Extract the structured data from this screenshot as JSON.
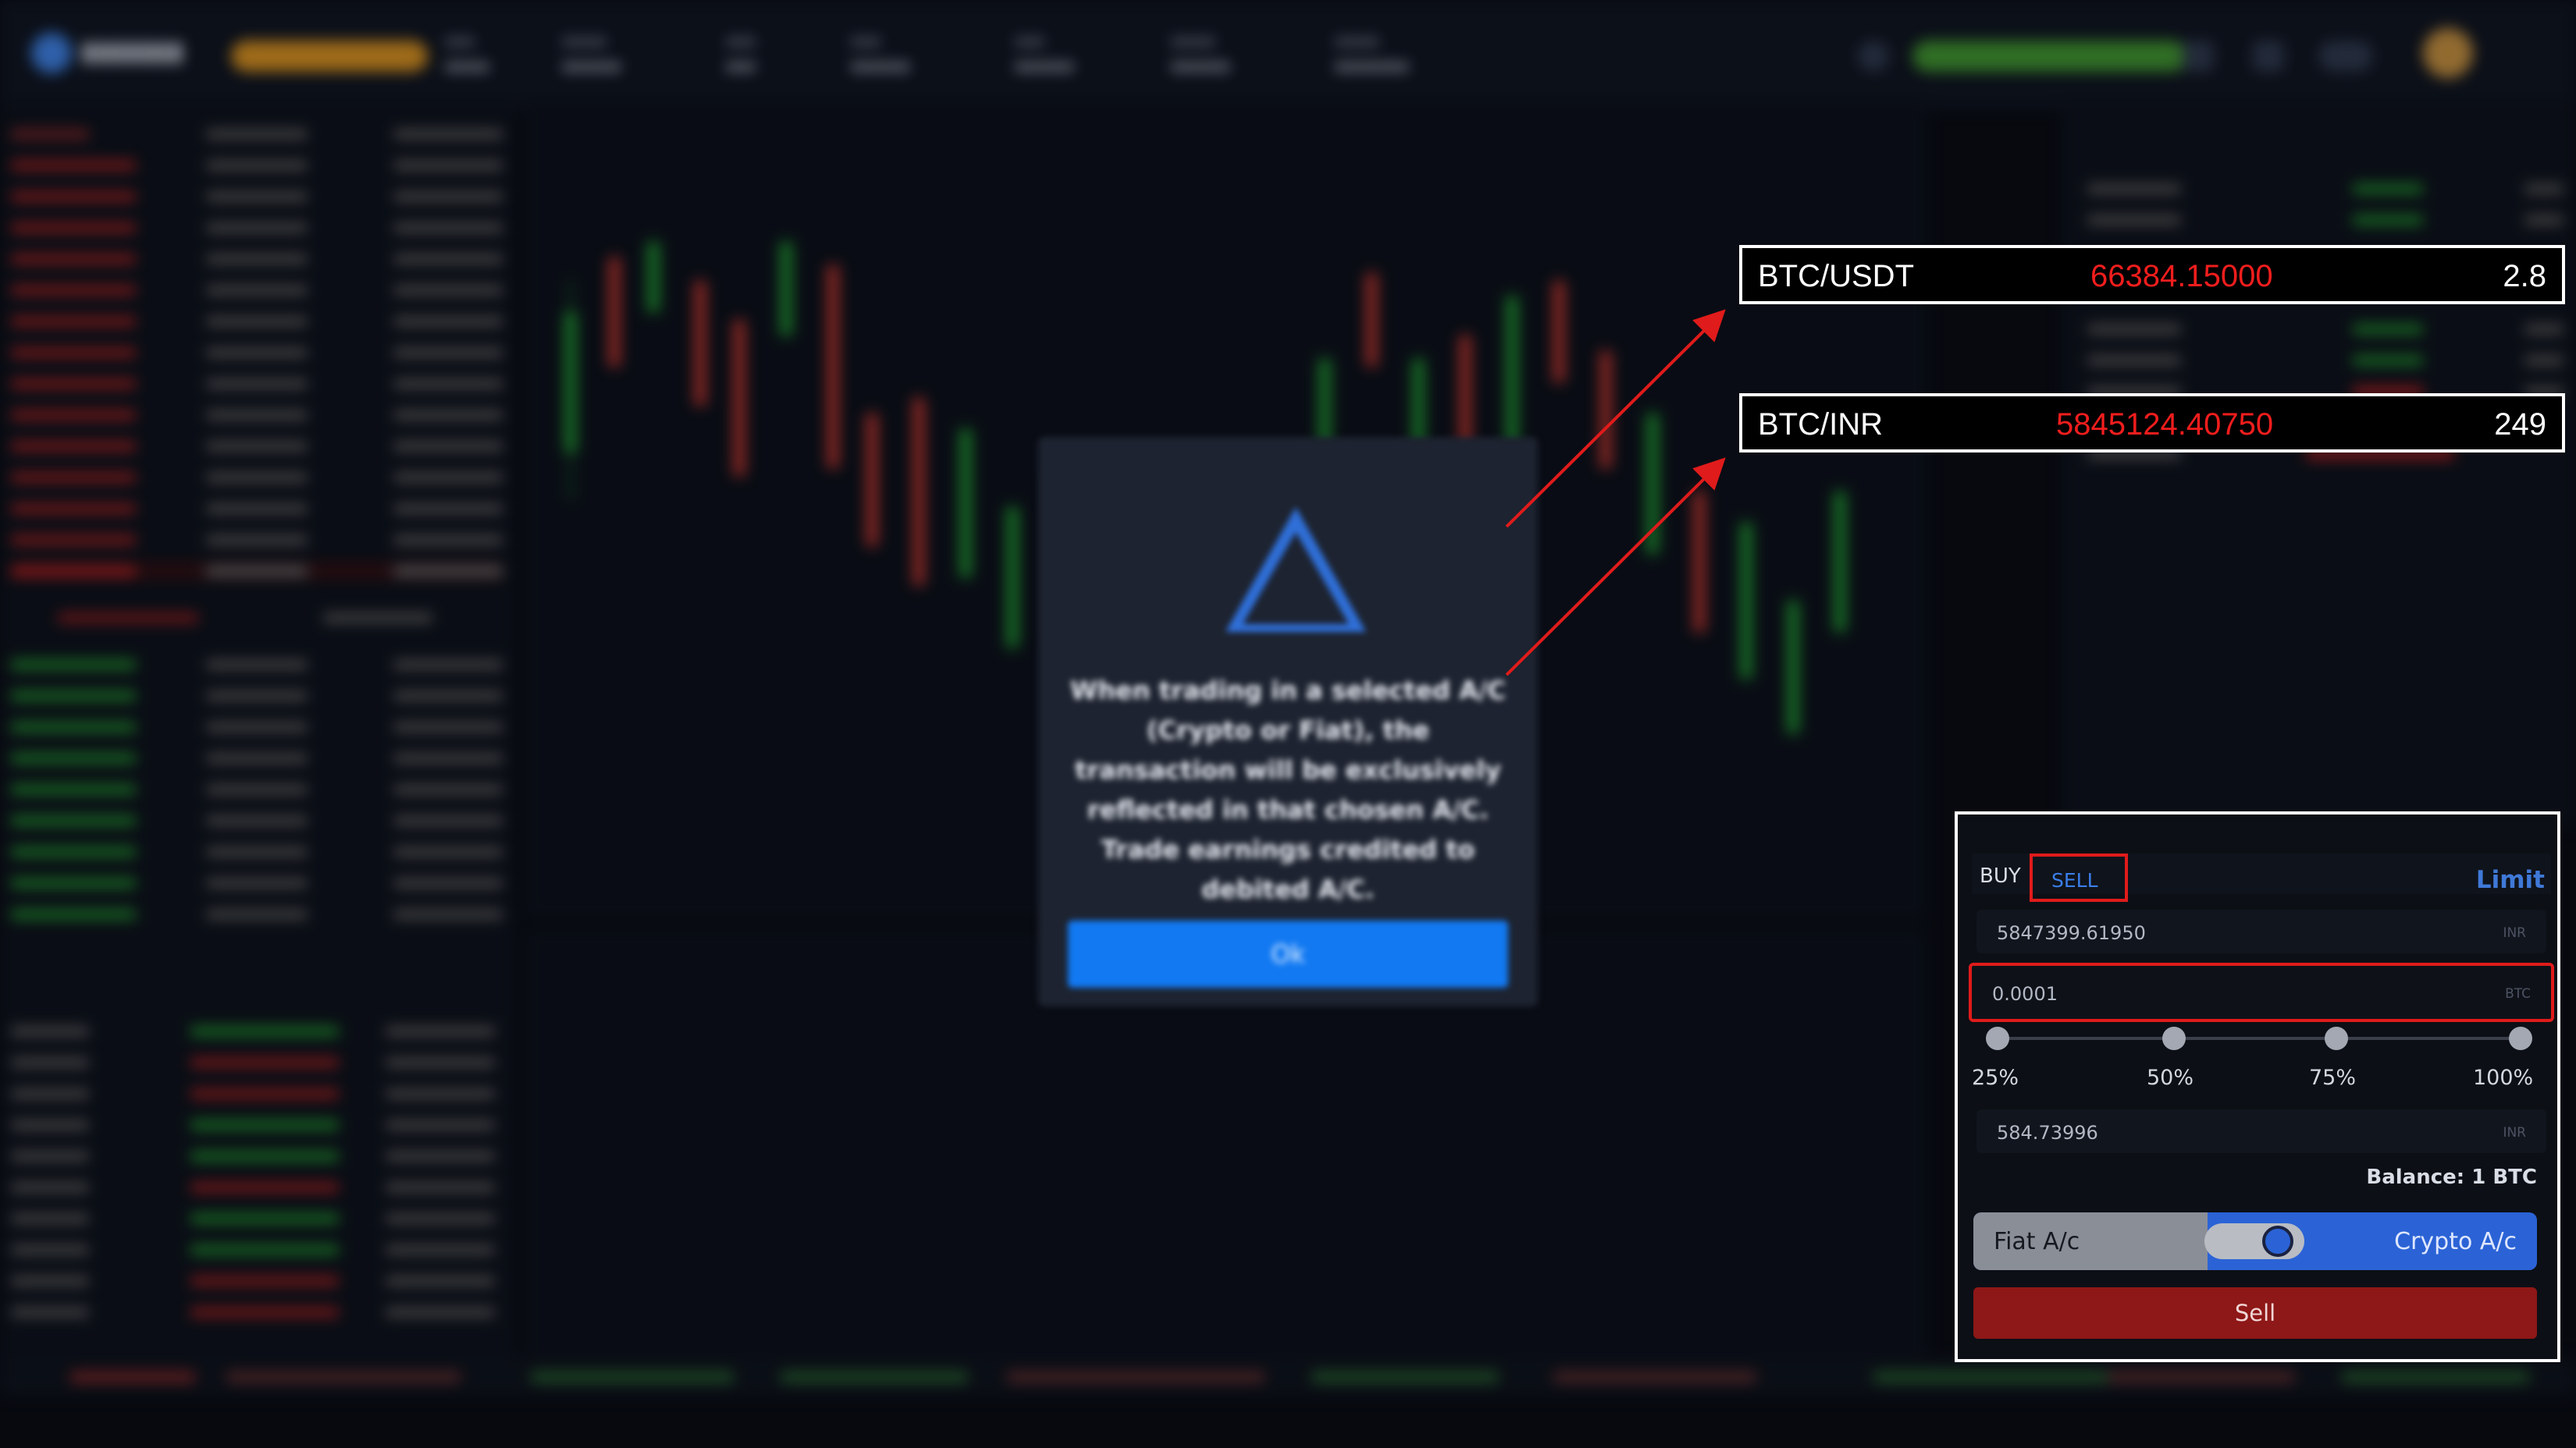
{
  "callouts": {
    "usdt": {
      "pair": "BTC/USDT",
      "price": "66384.15000",
      "volume": "2.8"
    },
    "inr": {
      "pair": "BTC/INR",
      "price": "5845124.40750",
      "volume": "249"
    }
  },
  "modal": {
    "text": "When trading in a selected A/C (Crypto or Fiat), the transaction will be exclusively reflected in that chosen A/C. Trade earnings credited to debited A/C.",
    "ok_label": "Ok"
  },
  "trade_panel": {
    "tab_buy": "BUY",
    "tab_sell": "SELL",
    "order_type": "Limit",
    "price_value": "5847399.61950",
    "price_unit": "INR",
    "amount_value": "0.0001",
    "amount_unit": "BTC",
    "slider": {
      "labels": [
        "25%",
        "50%",
        "75%",
        "100%"
      ]
    },
    "total_value": "584.73996",
    "total_unit": "INR",
    "balance": "Balance: 1 BTC",
    "account_toggle": {
      "left": "Fiat A/c",
      "right": "Crypto A/c",
      "selected": "Crypto A/c"
    },
    "submit_label": "Sell"
  },
  "colors": {
    "highlight_border": "#e01b1b",
    "sell_button": "#8e1717",
    "accent_blue": "#2b63d6",
    "price_red": "#f21d1d"
  }
}
